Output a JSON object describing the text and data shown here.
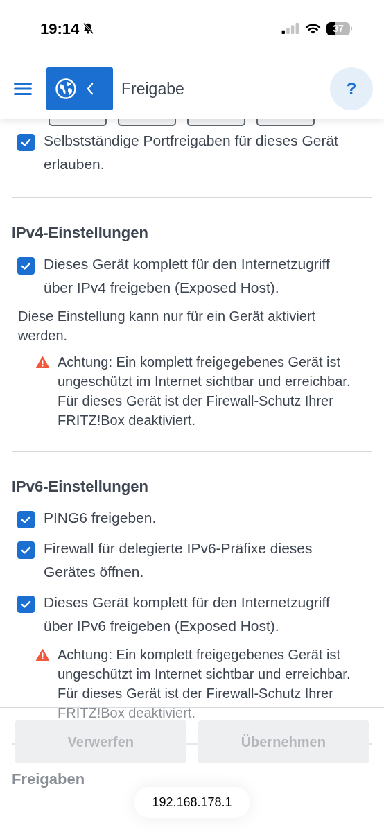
{
  "status_bar": {
    "time": "19:14",
    "silent": true,
    "battery": "37"
  },
  "header": {
    "title": "Freigabe",
    "help": "?"
  },
  "top_items": [
    {
      "kind": "checkbox",
      "label": "Selbstständige Portfreigaben für dieses Gerät erlauben.",
      "checked": true
    }
  ],
  "sections": [
    {
      "heading": "IPv4-Einstellungen",
      "items": [
        {
          "kind": "checkbox",
          "label": "Dieses Gerät komplett für den Internetzugriff über IPv4 freigeben (Exposed Host).",
          "checked": true
        },
        {
          "kind": "note",
          "text": "Diese Einstellung kann nur für ein Gerät aktiviert werden."
        },
        {
          "kind": "warning",
          "text": "Achtung: Ein komplett freigegebenes Gerät ist ungeschützt im Internet sichtbar und erreichbar. Für dieses Gerät ist der Firewall-Schutz Ihrer FRITZ!Box deaktiviert."
        }
      ]
    },
    {
      "heading": "IPv6-Einstellungen",
      "items": [
        {
          "kind": "checkbox",
          "label": "PING6 freigeben.",
          "checked": true
        },
        {
          "kind": "checkbox",
          "label": "Firewall für delegierte IPv6-Präfixe dieses Gerätes öffnen.",
          "checked": true
        },
        {
          "kind": "checkbox",
          "label": "Dieses Gerät komplett für den Internetzugriff über IPv6 freigeben (Exposed Host).",
          "checked": true
        },
        {
          "kind": "warning",
          "text": "Achtung: Ein komplett freigegebenes Gerät ist ungeschützt im Internet sichtbar und erreichbar. Für dieses Gerät ist der Firewall-Schutz Ihrer FRITZ!Box deaktiviert."
        }
      ]
    },
    {
      "heading": "Freigaben"
    }
  ],
  "actions": [
    {
      "label": "Verwerfen",
      "disabled": true
    },
    {
      "label": "Übernehmen",
      "disabled": true
    }
  ],
  "address_bar": {
    "url": "192.168.178.1"
  }
}
